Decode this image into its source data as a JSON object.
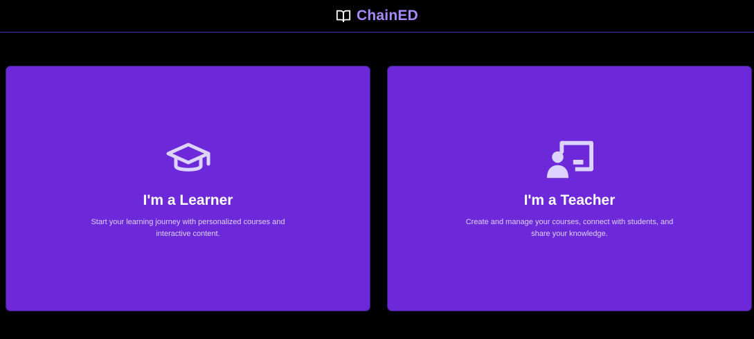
{
  "app": {
    "name": "ChainED",
    "logo_icon": "book-open-icon"
  },
  "colors": {
    "background": "#000000",
    "brand": "#a78bfa",
    "card": "#6d28d9",
    "header_border": "#4c35b5"
  },
  "roles": [
    {
      "id": "learner",
      "icon": "graduation-cap-icon",
      "title": "I'm a Learner",
      "description": "Start your learning journey with personalized courses and interactive content."
    },
    {
      "id": "teacher",
      "icon": "presentation-board-icon",
      "title": "I'm a Teacher",
      "description": "Create and manage your courses, connect with students, and share your knowledge."
    }
  ]
}
